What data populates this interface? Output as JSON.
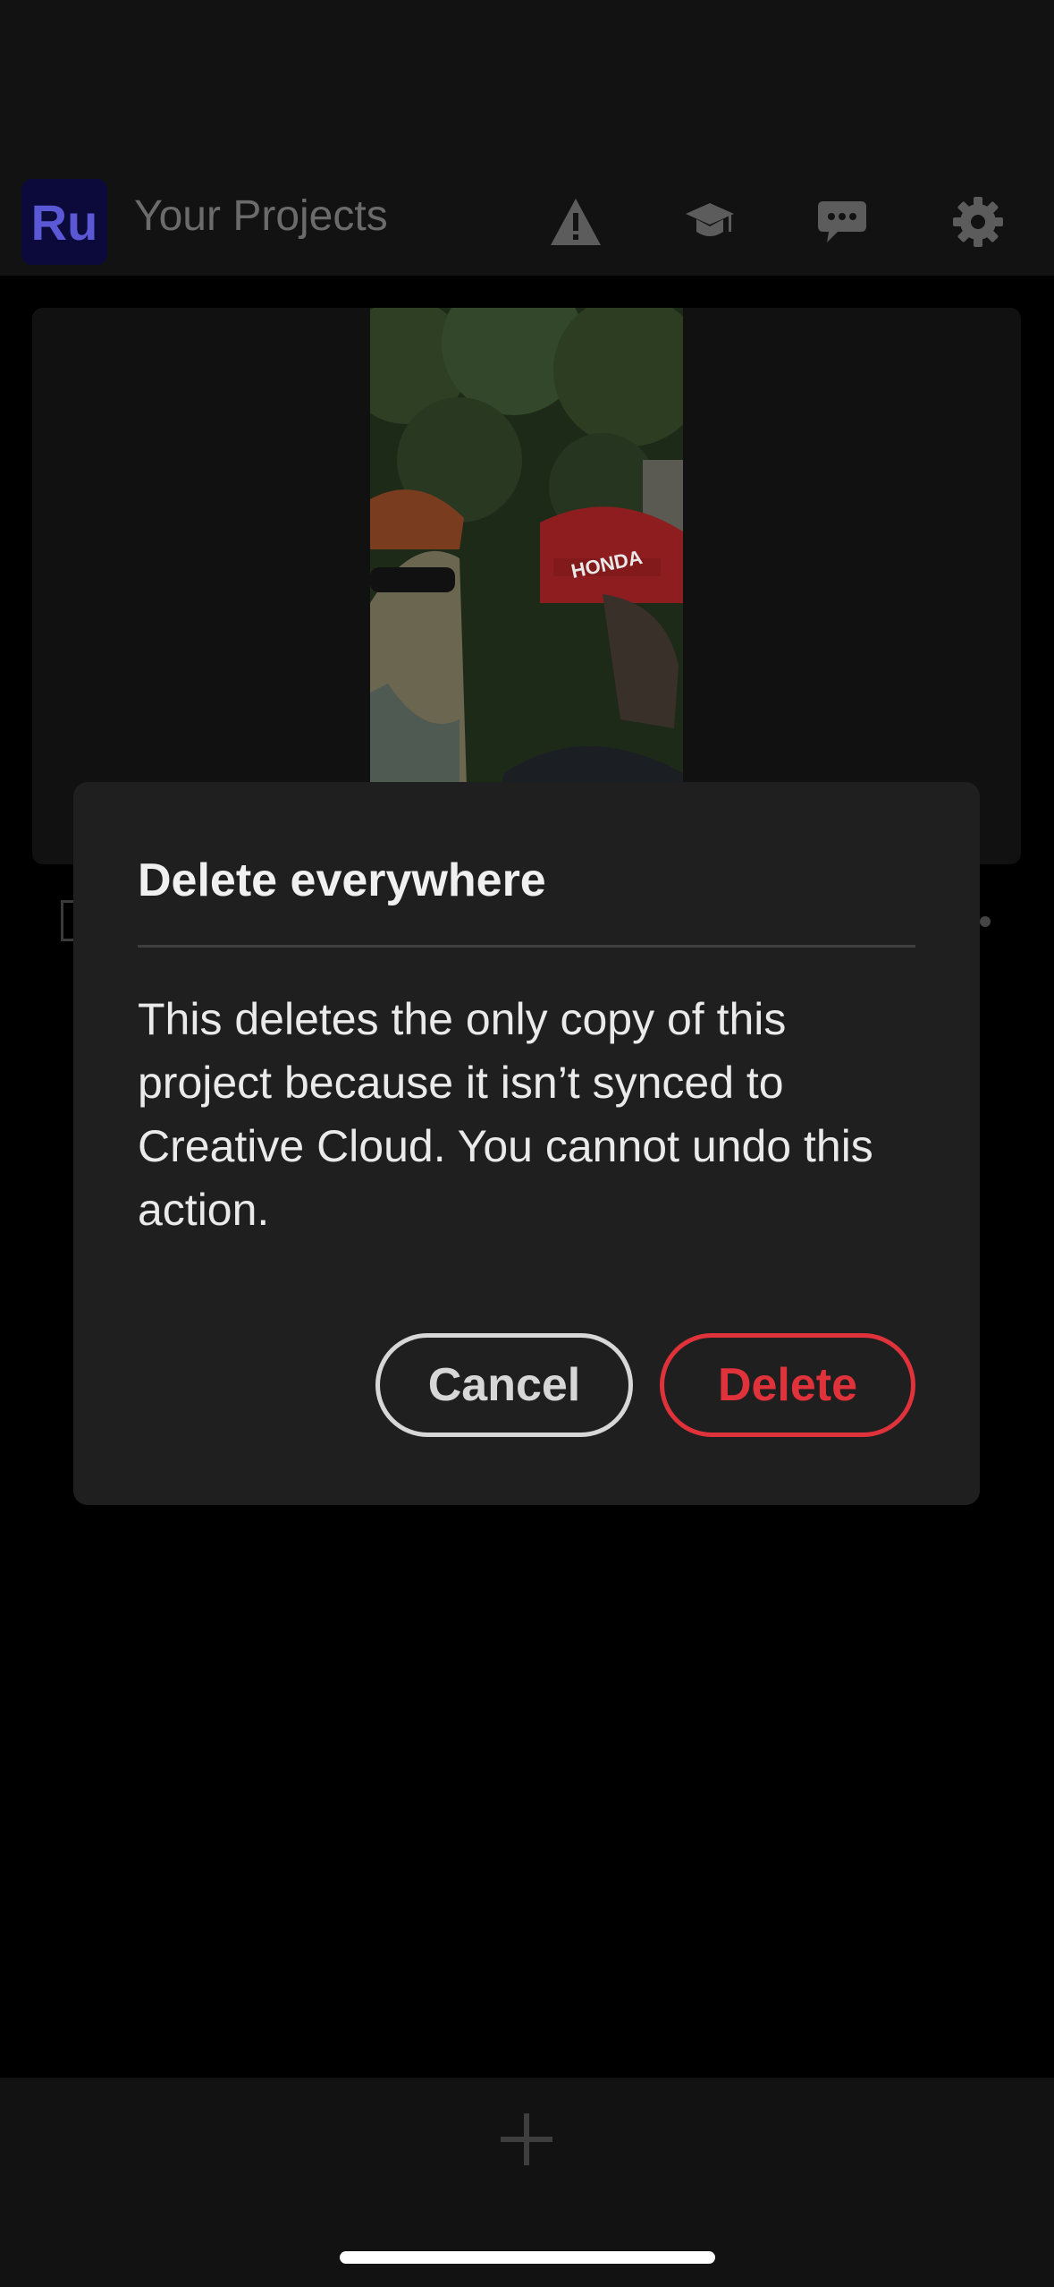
{
  "header": {
    "app_logo_text": "Ru",
    "title": "Your Projects",
    "icons": [
      "warning-icon",
      "learn-icon",
      "feedback-icon",
      "settings-icon"
    ]
  },
  "project": {
    "thumbnail_text": "HONDA"
  },
  "dialog": {
    "title": "Delete everywhere",
    "body": "This deletes the only copy of this project because it isn’t synced to Creative Cloud. You cannot undo this action.",
    "cancel_label": "Cancel",
    "delete_label": "Delete"
  },
  "colors": {
    "accent_delete": "#e0323a",
    "logo_bg": "#0b0a3a",
    "logo_text": "#5b58d6"
  }
}
